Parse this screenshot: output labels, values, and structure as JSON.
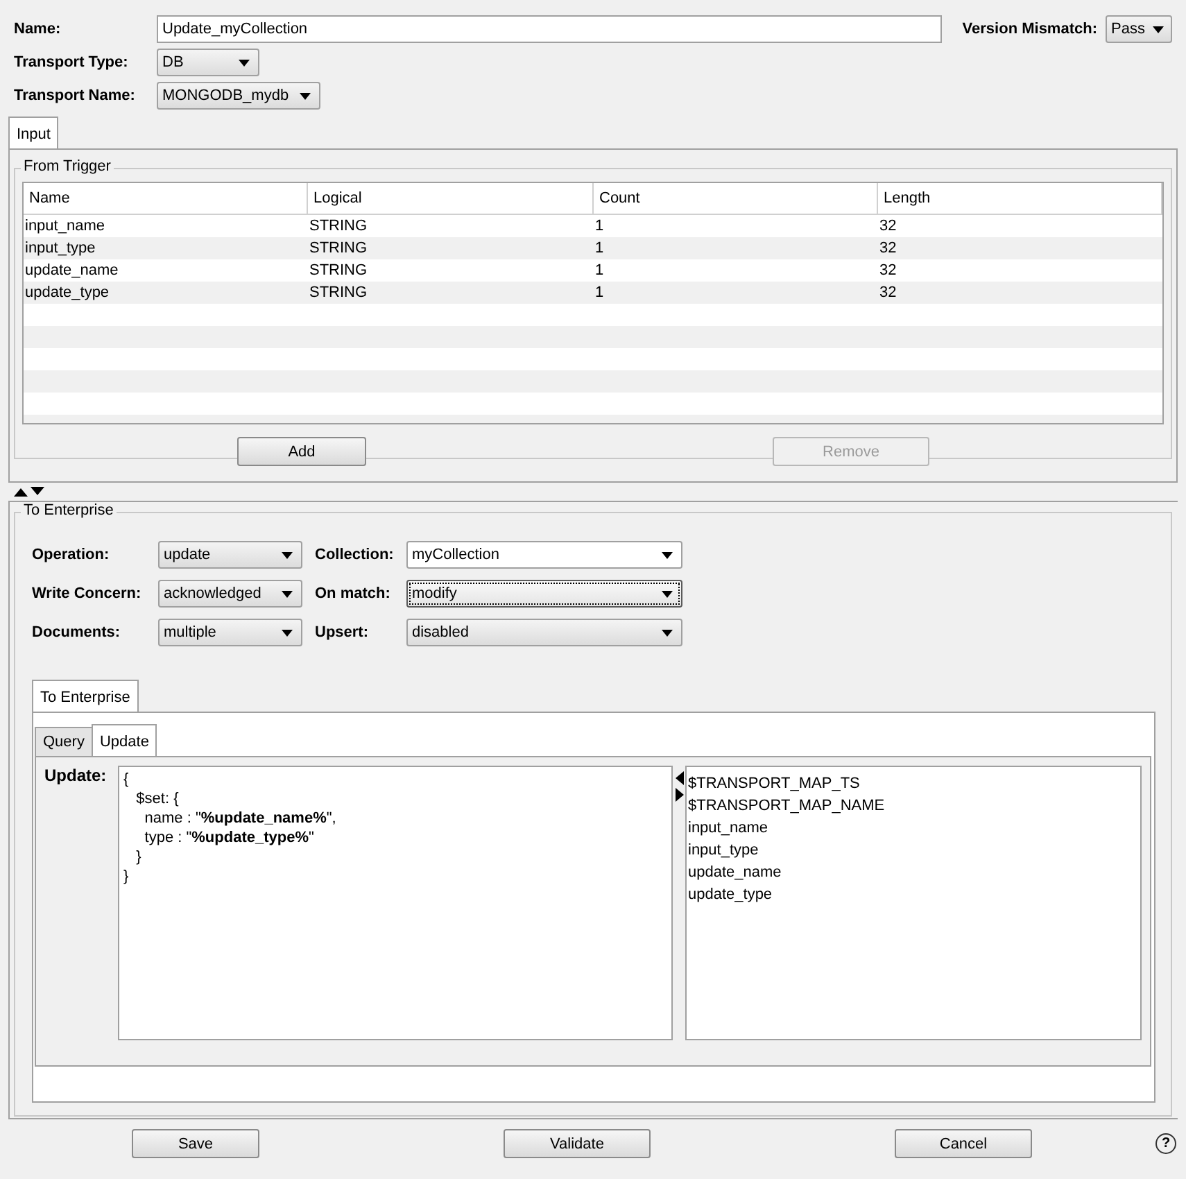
{
  "header": {
    "name": {
      "label": "Name:",
      "value": "Update_myCollection"
    },
    "version_mismatch": {
      "label": "Version Mismatch:",
      "value": "Pass"
    },
    "transport_type": {
      "label": "Transport Type:",
      "value": "DB"
    },
    "transport_name": {
      "label": "Transport Name:",
      "value": "MONGODB_mydb"
    }
  },
  "tabs": [
    {
      "label": "Input",
      "selected": true
    }
  ],
  "from_trigger": {
    "title": "From Trigger",
    "columns": [
      "Name",
      "Logical",
      "Count",
      "Length"
    ],
    "rows": [
      [
        "input_name",
        "STRING",
        "1",
        "32"
      ],
      [
        "input_type",
        "STRING",
        "1",
        "32"
      ],
      [
        "update_name",
        "STRING",
        "1",
        "32"
      ],
      [
        "update_type",
        "STRING",
        "1",
        "32"
      ]
    ],
    "buttons": [
      {
        "label": "Add",
        "disabled": false
      },
      {
        "label": "Remove",
        "disabled": true
      }
    ]
  },
  "to_enterprise": {
    "title": "To Enterprise",
    "fields": [
      {
        "label": "Operation:",
        "value": "update",
        "editable": false,
        "focused": false
      },
      {
        "label": "Collection:",
        "value": "myCollection",
        "editable": true,
        "focused": false
      },
      {
        "label": "Write Concern:",
        "value": "acknowledged",
        "editable": false,
        "focused": false
      },
      {
        "label": "On match:",
        "value": "modify",
        "editable": false,
        "focused": true
      },
      {
        "label": "Documents:",
        "value": "multiple",
        "editable": false,
        "focused": false
      },
      {
        "label": "Upsert:",
        "value": "disabled",
        "editable": false,
        "focused": false
      }
    ],
    "tabs": [
      {
        "label": "To Enterprise",
        "selected": true
      }
    ],
    "sub_tabs": [
      {
        "label": "Query",
        "selected": false
      },
      {
        "label": "Update",
        "selected": true
      }
    ],
    "update_label": "Update:",
    "code_lines": [
      "{",
      "   $set: {",
      "     name : \"**%update_name%**\",",
      "     type : \"**%update_type%**\"",
      "   }",
      "}"
    ],
    "variables": [
      "$TRANSPORT_MAP_TS",
      "$TRANSPORT_MAP_NAME",
      "input_name",
      "input_type",
      "update_name",
      "update_type"
    ]
  },
  "buttons": [
    "Save",
    "Validate",
    "Cancel"
  ],
  "help": "?"
}
